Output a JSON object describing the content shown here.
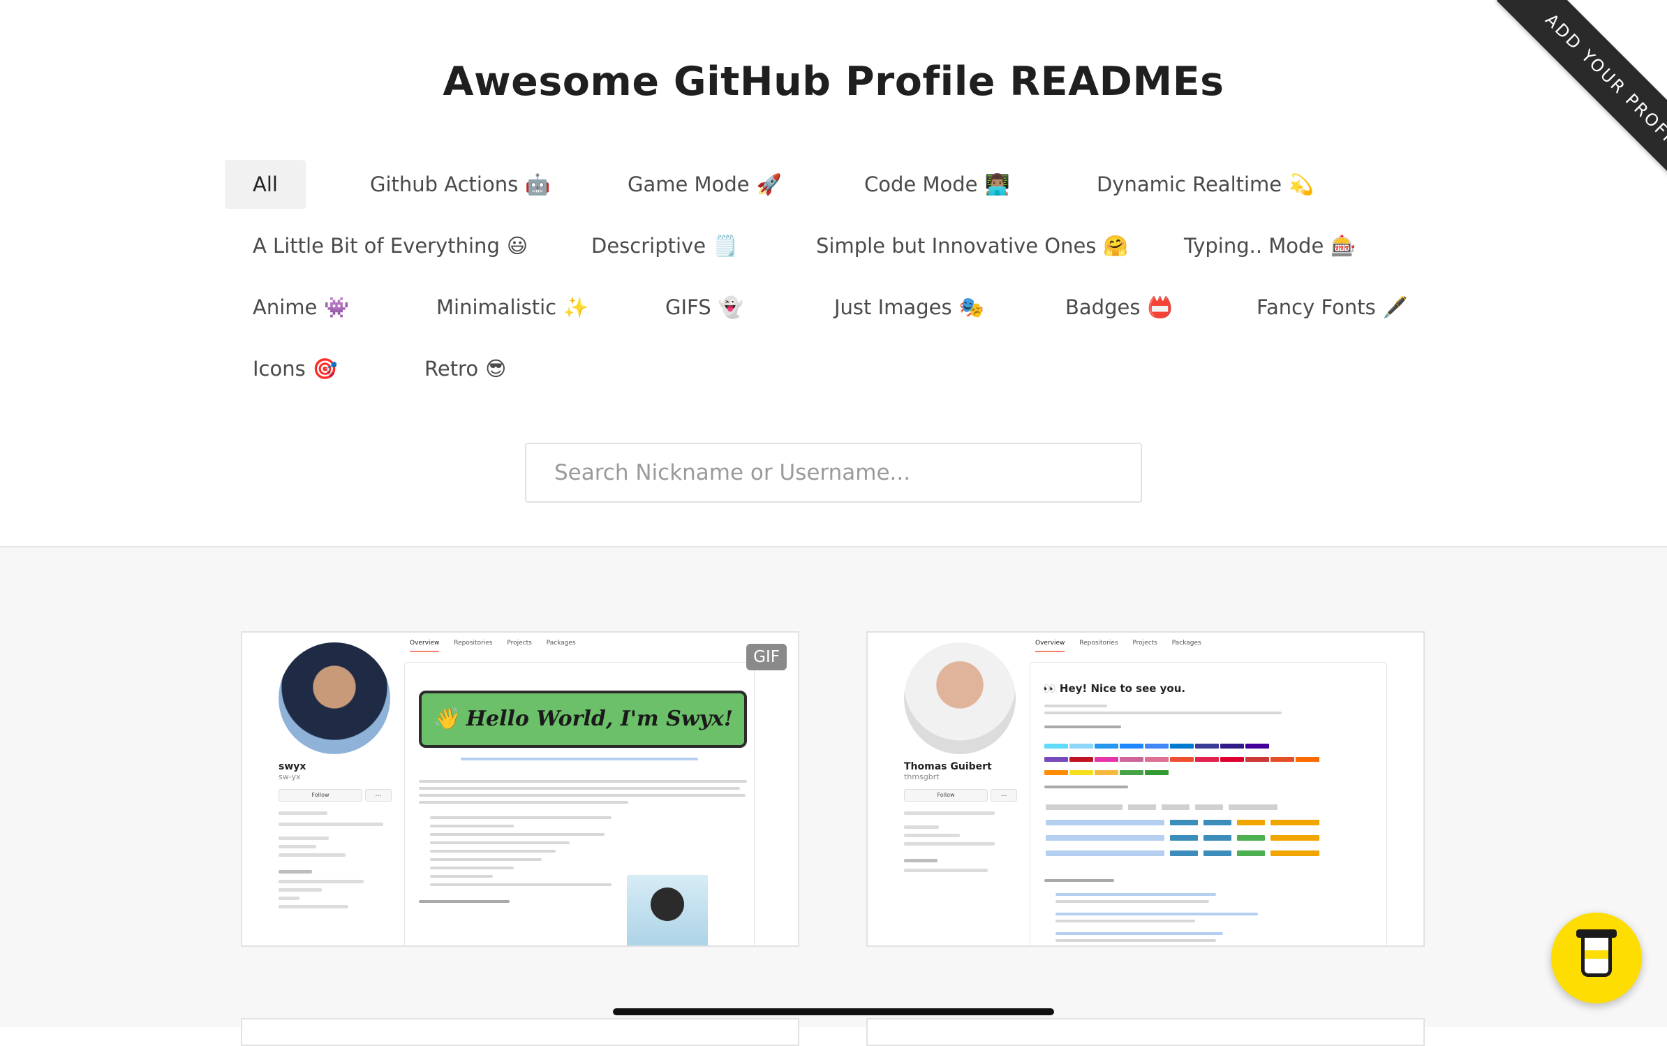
{
  "header": {
    "title": "Awesome GitHub Profile READMEs",
    "ribbon": "ADD YOUR PROFILE"
  },
  "categories": [
    {
      "label": "All",
      "emoji": ""
    },
    {
      "label": "Github Actions",
      "emoji": "🤖"
    },
    {
      "label": "Game Mode",
      "emoji": "🚀"
    },
    {
      "label": "Code Mode",
      "emoji": "👨🏽‍💻"
    },
    {
      "label": "Dynamic Realtime",
      "emoji": "💫"
    },
    {
      "label": "A Little Bit of Everything",
      "emoji": "😃"
    },
    {
      "label": "Descriptive",
      "emoji": "🗒️"
    },
    {
      "label": "Simple but Innovative Ones",
      "emoji": "🤗"
    },
    {
      "label": "Typing.. Mode",
      "emoji": "🎰"
    },
    {
      "label": "Anime",
      "emoji": "👾"
    },
    {
      "label": "Minimalistic",
      "emoji": "✨"
    },
    {
      "label": "GIFS",
      "emoji": "👻"
    },
    {
      "label": "Just Images",
      "emoji": "🎭"
    },
    {
      "label": "Badges",
      "emoji": "📛"
    },
    {
      "label": "Fancy Fonts",
      "emoji": "🖋️"
    },
    {
      "label": "Icons",
      "emoji": "🎯"
    },
    {
      "label": "Retro",
      "emoji": "😎"
    }
  ],
  "search": {
    "placeholder": "Search Nickname or Username..."
  },
  "cards": [
    {
      "badge": "GIF",
      "name": "swyx",
      "username": "sw-yx",
      "follow": "Follow",
      "tabs": [
        "Overview",
        "Repositories",
        "Projects",
        "Packages"
      ],
      "banner": "👋 Hello World, I'm Swyx!"
    },
    {
      "name": "Thomas Guibert",
      "username": "thmsgbrt",
      "follow": "Follow",
      "tabs": [
        "Overview",
        "Repositories",
        "Projects",
        "Packages"
      ],
      "greeting": "👀 Hey! Nice to see you."
    }
  ],
  "colors": {
    "ribbon": "#2a2a2a",
    "coffee": "#fedd03",
    "active_filter_bg": "#f1f1f1",
    "banner_green": "#6cc06a"
  }
}
